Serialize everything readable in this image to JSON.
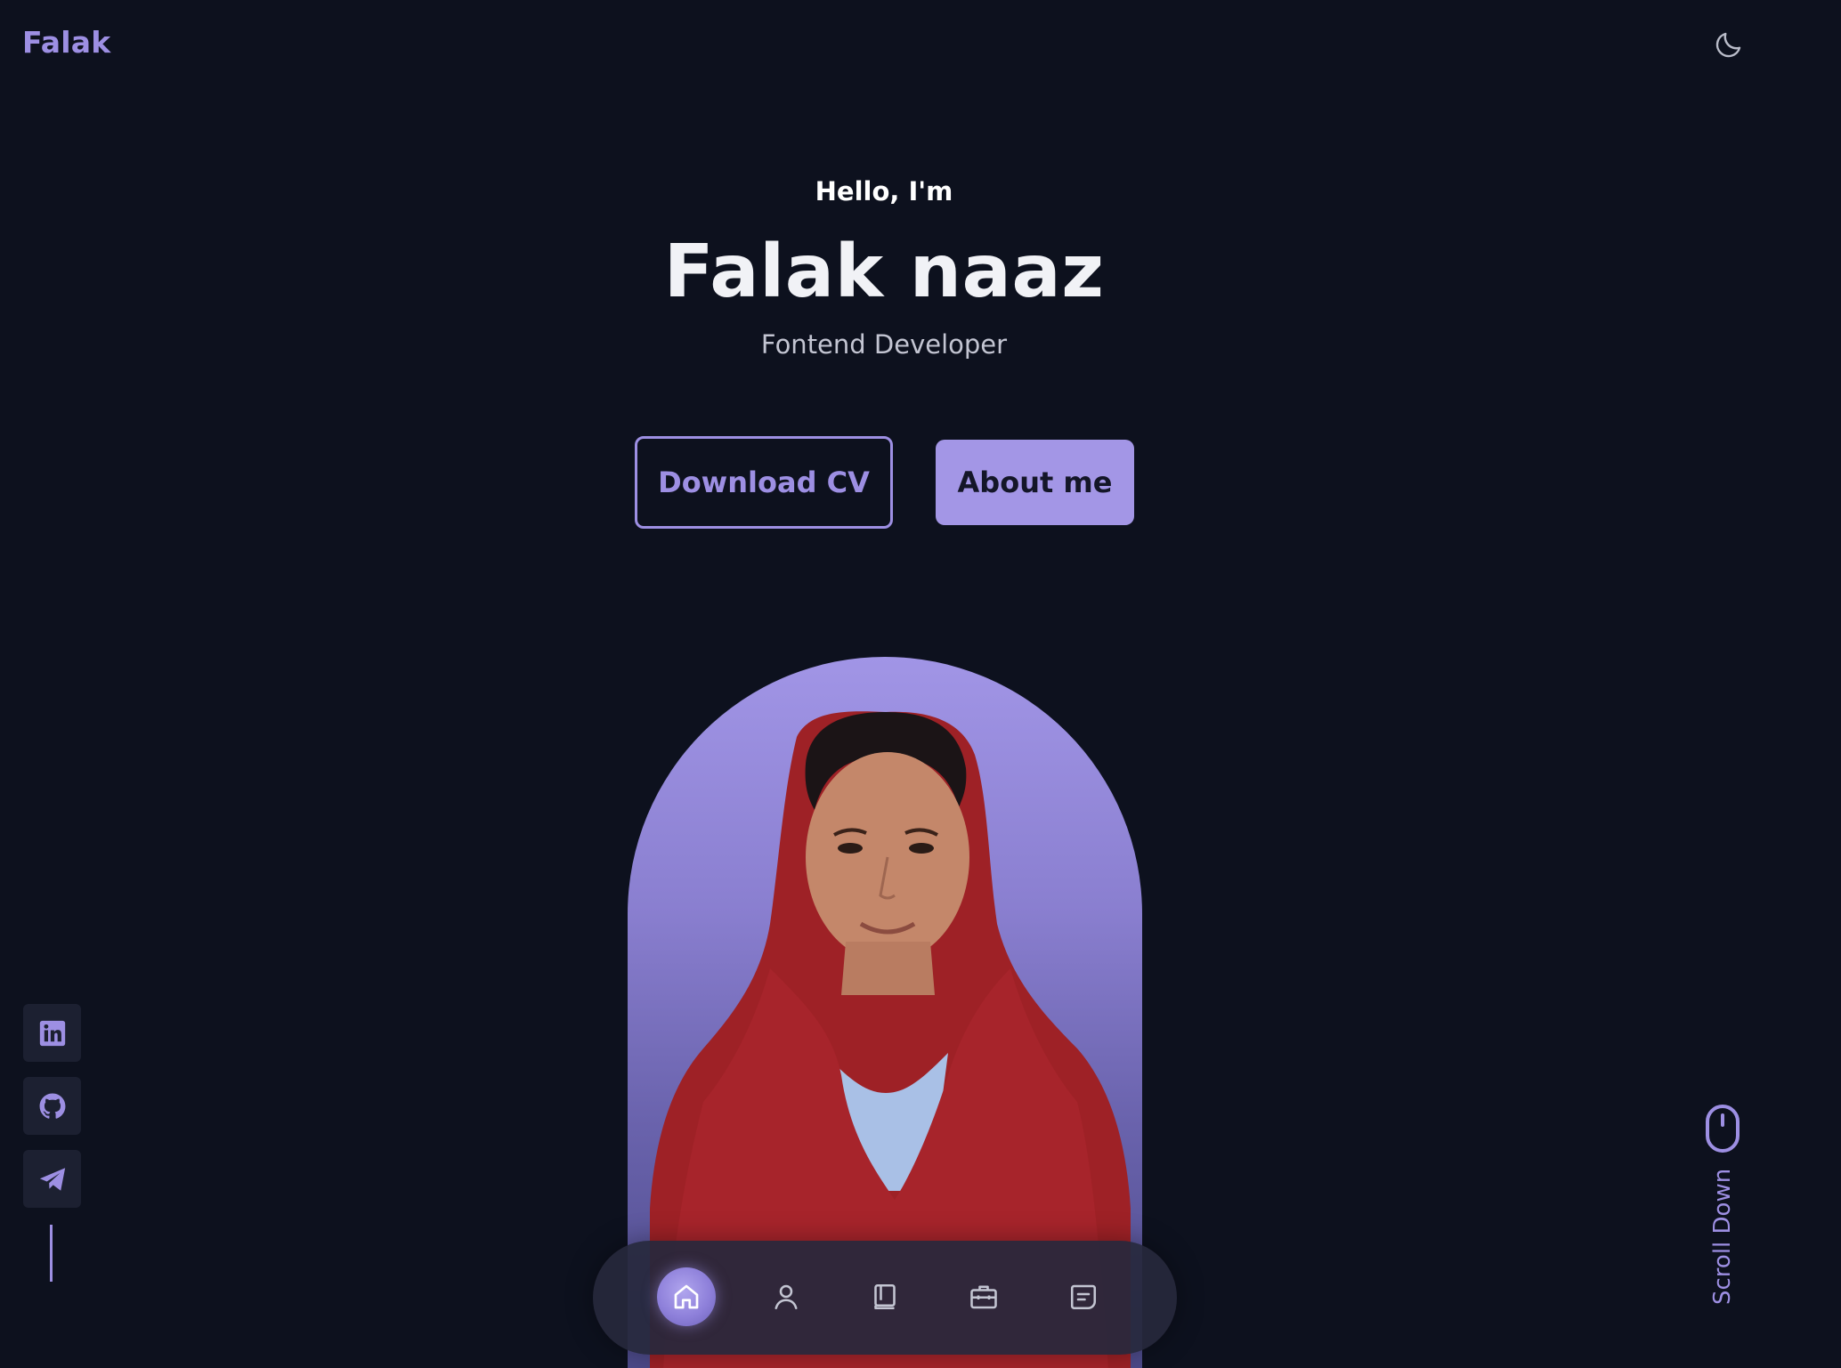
{
  "header": {
    "logo": "Falak",
    "theme_toggle_icon": "moon-icon"
  },
  "hero": {
    "greeting": "Hello, I'm",
    "name": "Falak naaz",
    "role": "Fontend Developer",
    "download_cv_label": "Download CV",
    "about_me_label": "About me"
  },
  "social": [
    {
      "icon": "linkedin-icon"
    },
    {
      "icon": "github-icon"
    },
    {
      "icon": "telegram-icon"
    }
  ],
  "scroll": {
    "label": "Scroll Down",
    "icon": "mouse-icon"
  },
  "bottom_nav": {
    "items": [
      {
        "icon": "home-icon",
        "active": true
      },
      {
        "icon": "user-icon",
        "active": false
      },
      {
        "icon": "book-icon",
        "active": false
      },
      {
        "icon": "briefcase-icon",
        "active": false
      },
      {
        "icon": "message-icon",
        "active": false
      }
    ]
  },
  "colors": {
    "background": "#0d111e",
    "accent": "#9d8fe3",
    "button_fill": "#a396e6",
    "text": "#f1f2f6"
  }
}
